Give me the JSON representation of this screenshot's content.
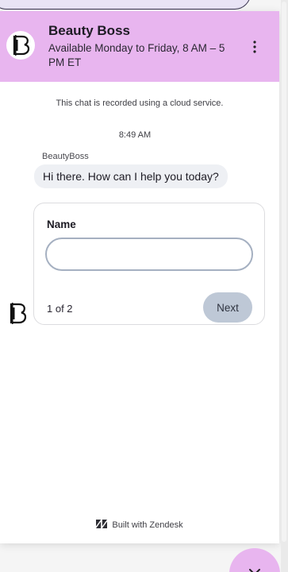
{
  "header": {
    "title": "Beauty Boss",
    "subtitle": "Available Monday to Friday, 8 AM – 5 PM ET",
    "menu_icon": "more-vertical-icon",
    "logo_icon": "beautyboss-logo-icon"
  },
  "chat": {
    "notice": "This chat is recorded using a cloud service.",
    "timestamp": "8:49 AM",
    "sender": "BeautyBoss",
    "message": "Hi there. How can I help you today?"
  },
  "form": {
    "field_label": "Name",
    "field_value": "",
    "step": "1 of 2",
    "next_label": "Next"
  },
  "footer": {
    "text": "Built with Zendesk",
    "icon": "zendesk-logo-icon"
  },
  "launcher": {
    "icon": "close-icon"
  },
  "colors": {
    "header_bg": "#e8b5ef",
    "bubble_bg": "#eef0f4",
    "next_button_bg": "#bec8d6",
    "input_border": "#a5b0c1"
  }
}
